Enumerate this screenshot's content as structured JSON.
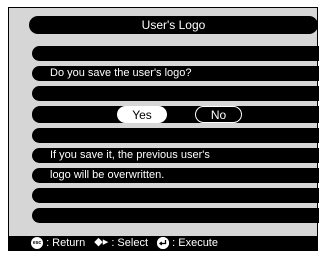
{
  "dialog": {
    "title": "User's Logo",
    "question": "Do you save the user's logo?",
    "yes_label": "Yes",
    "no_label": "No",
    "warning_line1": "If you save it, the previous user's",
    "warning_line2": "logo will be overwritten."
  },
  "footer": {
    "esc_icon_text": "esc",
    "return_label": ": Return",
    "select_glyph": "◆▸",
    "select_label": ": Select",
    "execute_label": ": Execute"
  },
  "colors": {
    "background": "#ffffff",
    "frame": "#d6d6d6",
    "bar": "#000000",
    "text": "#ffffff"
  },
  "icons": [
    "esc-button-icon",
    "left-right-arrows-icon",
    "enter-button-icon"
  ]
}
